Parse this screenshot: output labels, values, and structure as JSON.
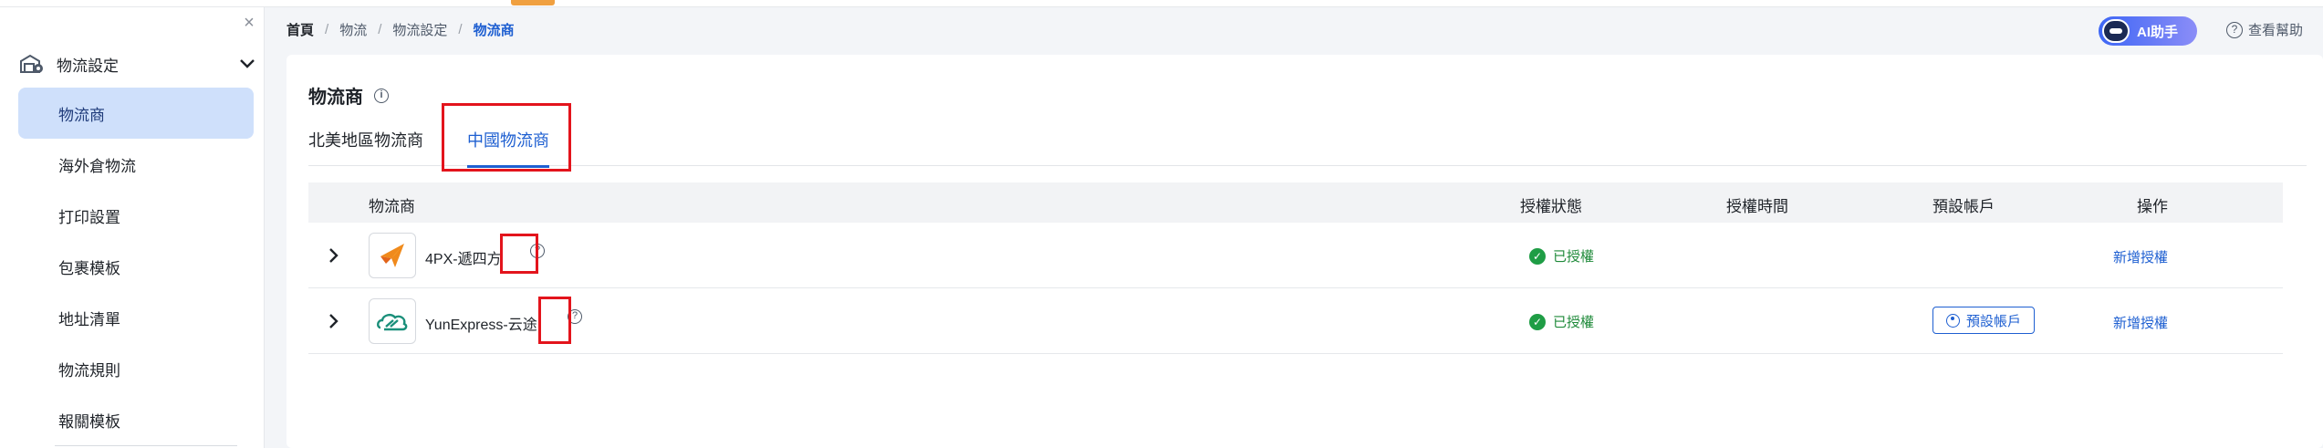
{
  "sidebar": {
    "close_symbol": "×",
    "group": {
      "label": "物流設定",
      "icon": "warehouse-settings-icon",
      "chevron": "chevron-down-icon"
    },
    "items": [
      {
        "label": "物流商",
        "active": true
      },
      {
        "label": "海外倉物流",
        "active": false
      },
      {
        "label": "打印設置",
        "active": false
      },
      {
        "label": "包裹模板",
        "active": false
      },
      {
        "label": "地址清單",
        "active": false
      },
      {
        "label": "物流規則",
        "active": false
      },
      {
        "label": "報關模板",
        "active": false
      }
    ]
  },
  "breadcrumb": {
    "items": [
      "首頁",
      "物流",
      "物流設定",
      "物流商"
    ],
    "separator": "/"
  },
  "header": {
    "ai_button_label": "AI助手",
    "help_label": "查看幫助",
    "help_icon": "?"
  },
  "main": {
    "title": "物流商",
    "info_icon": "i",
    "tabs": [
      {
        "label": "北美地區物流商",
        "active": false
      },
      {
        "label": "中國物流商",
        "active": true
      }
    ],
    "table": {
      "columns": [
        "物流商",
        "授權狀態",
        "授權時間",
        "預設帳戶",
        "操作"
      ],
      "rows": [
        {
          "carrier": "4PX-遞四方",
          "logo": "4px-logo-icon",
          "help": "?",
          "status": "已授權",
          "auth_time": "",
          "default_account": "",
          "action": "新增授權"
        },
        {
          "carrier": "YunExpress-云途",
          "logo": "yunexpress-logo-icon",
          "help": "?",
          "status": "已授權",
          "auth_time": "",
          "default_account": "預設帳戶",
          "action": "新增授權"
        }
      ]
    }
  },
  "colors": {
    "accent": "#1e5fd1",
    "active_bg": "#cfe0fb",
    "success": "#1f9d45",
    "highlight": "#e3141c"
  }
}
